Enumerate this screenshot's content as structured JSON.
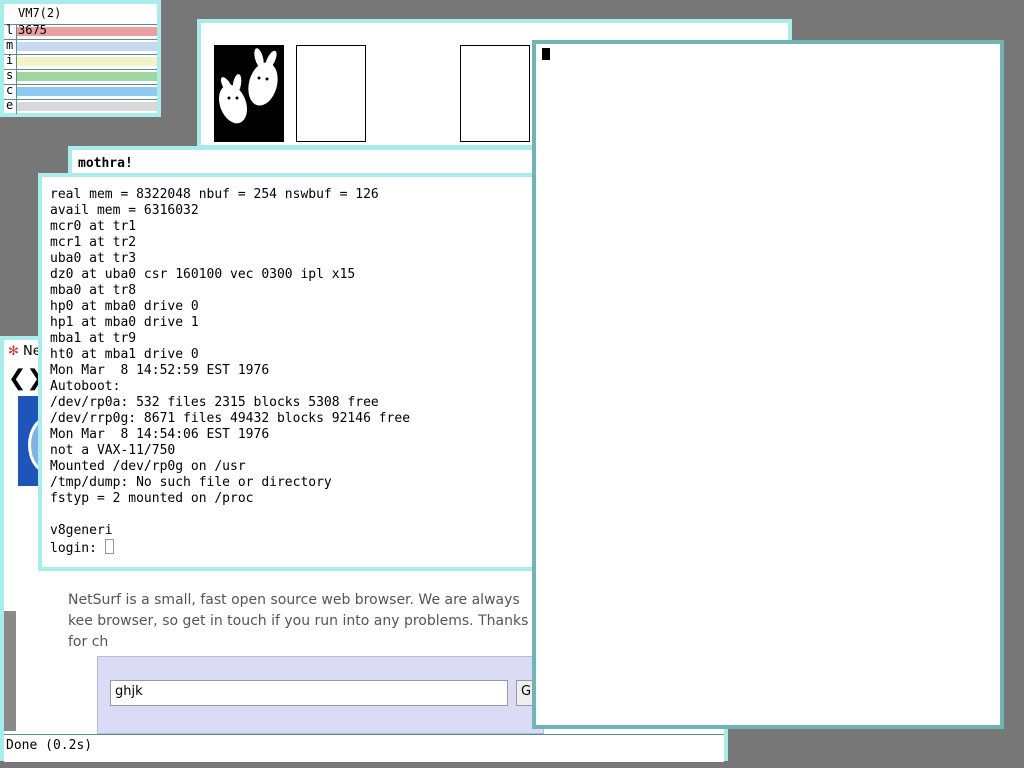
{
  "stats": {
    "title": "VM7(2)",
    "value": "3675",
    "labels": [
      "l",
      "m",
      "i",
      "s",
      "c",
      "e"
    ],
    "colors": [
      "#e8a0a0",
      "#c8d8f0",
      "#f4f0c8",
      "#9fd69f",
      "#8fc8f0",
      "#d8d8d8"
    ]
  },
  "mothra": {
    "title": "mothra!"
  },
  "console": {
    "lines": [
      "real mem = 8322048 nbuf = 254 nswbuf = 126",
      "avail mem = 6316032",
      "mcr0 at tr1",
      "mcr1 at tr2",
      "uba0 at tr3",
      "dz0 at uba0 csr 160100 vec 0300 ipl x15",
      "mba0 at tr8",
      "hp0 at mba0 drive 0",
      "hp1 at mba0 drive 1",
      "mba1 at tr9",
      "ht0 at mba1 drive 0",
      "Mon Mar  8 14:52:59 EST 1976",
      "Autoboot:",
      "/dev/rp0a: 532 files 2315 blocks 5308 free",
      "/dev/rrp0g: 8671 files 49432 blocks 92146 free",
      "Mon Mar  8 14:54:06 EST 1976",
      "not a VAX-11/750",
      "Mounted /dev/rp0g on /usr",
      "/tmp/dump: No such file or directory",
      "fstyp = 2 mounted on /proc",
      "",
      "v8generi"
    ],
    "prompt": "login: "
  },
  "netsurf": {
    "tab_label": "Ne",
    "nav_arrows": "❮❯",
    "description": "NetSurf is a small, fast open source web browser. We are always kee browser, so get in touch if you run into any problems. Thanks for ch",
    "search_value": "ghjk",
    "go_label": "Go",
    "status": "Done (0.2s)"
  }
}
